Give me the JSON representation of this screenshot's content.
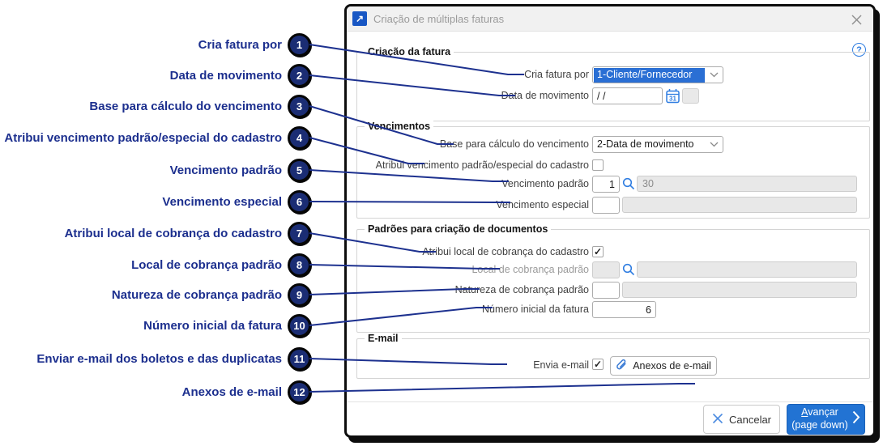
{
  "callouts": {
    "items": [
      {
        "n": "1",
        "label": "Cria fatura por"
      },
      {
        "n": "2",
        "label": "Data de movimento"
      },
      {
        "n": "3",
        "label": "Base para cálculo do vencimento"
      },
      {
        "n": "4",
        "label": "Atribui vencimento padrão/especial do cadastro"
      },
      {
        "n": "5",
        "label": "Vencimento padrão"
      },
      {
        "n": "6",
        "label": "Vencimento especial"
      },
      {
        "n": "7",
        "label": "Atribui local de cobrança do cadastro"
      },
      {
        "n": "8",
        "label": "Local de cobrança padrão"
      },
      {
        "n": "9",
        "label": "Natureza de cobrança padrão"
      },
      {
        "n": "10",
        "label": "Número inicial da fatura"
      },
      {
        "n": "11",
        "label": "Enviar e-mail dos boletos e das duplicatas"
      },
      {
        "n": "12",
        "label": "Anexos de e-mail"
      }
    ]
  },
  "dialog": {
    "title": "Criação de múltiplas faturas",
    "title_icon_glyph": "↗",
    "help_glyph": "?",
    "groups": {
      "criacao": {
        "legend": "Criação da fatura",
        "cria_fatura_por": {
          "label": "Cria fatura por",
          "value": "1-Cliente/Fornecedor"
        },
        "data_movimento": {
          "label": "Data de movimento",
          "value": "/ /",
          "calendar_glyph": "31"
        }
      },
      "vencimentos": {
        "legend": "Vencimentos",
        "base_calculo": {
          "label": "Base para cálculo do vencimento",
          "value": "2-Data de movimento"
        },
        "atribui_vencimento": {
          "label": "Atribui vencimento padrão/especial do cadastro",
          "check_glyph": ""
        },
        "vencimento_padrao": {
          "label": "Vencimento padrão",
          "code": "1",
          "descricao": "30"
        },
        "vencimento_especial": {
          "label": "Vencimento especial",
          "code": "",
          "descricao": ""
        }
      },
      "padroes": {
        "legend": "Padrões para criação de documentos",
        "atribui_local": {
          "label": "Atribui local de cobrança do cadastro",
          "check_glyph": "✓"
        },
        "local_cobranca": {
          "label": "Local de cobrança padrão",
          "code": "",
          "descricao": ""
        },
        "natureza_cobranca": {
          "label": "Natureza de cobrança padrão",
          "code": "",
          "descricao": ""
        },
        "numero_inicial": {
          "label": "Número inicial da fatura",
          "value": "6"
        }
      },
      "email": {
        "legend": "E-mail",
        "envia_email": {
          "label": "Envia e-mail",
          "check_glyph": "✓"
        },
        "anexos_button": "Anexos de e-mail"
      }
    },
    "footer": {
      "cancelar": "Cancelar",
      "avancar": "Avançar",
      "avancar_sub": "(page down)"
    }
  },
  "colors": {
    "accent_blue": "#2a6fd4",
    "icon_blue": "#2f7de1",
    "button_blue": "#2273d3",
    "callout_navy": "#1c2f8e"
  }
}
